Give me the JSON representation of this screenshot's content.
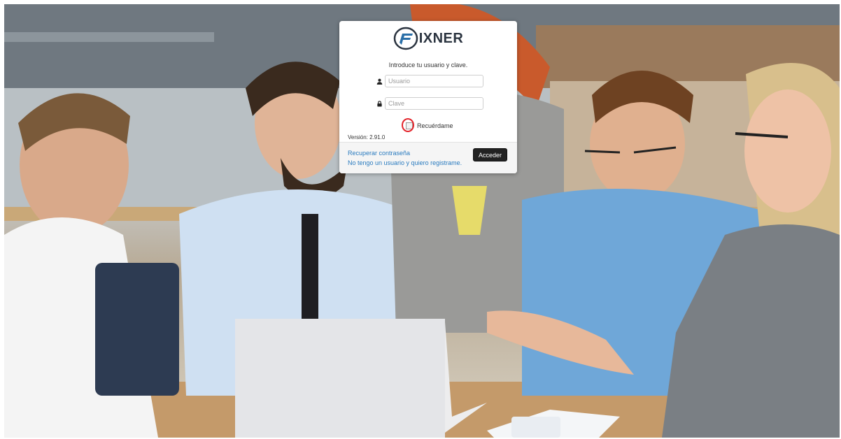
{
  "brand": {
    "name": "IXNER",
    "logo_icon": "fixner-f-logo-icon",
    "color": "#2b3440",
    "accent": "#2a6fa8"
  },
  "login": {
    "intro": "Introduce tu usuario y clave.",
    "username_placeholder": "Usuario",
    "username_value": "",
    "username_icon": "user-icon",
    "password_placeholder": "Clave",
    "password_value": "",
    "password_icon": "lock-icon",
    "remember_label": "Recuérdame",
    "remember_checked": false,
    "version": "Versión: 2.91.0",
    "recover_link": "Recuperar contraseña",
    "register_link": "No tengo un usuario y quiero registrame.",
    "submit_label": "Acceder"
  },
  "colors": {
    "link": "#2a7bbf",
    "button_bg": "#222222",
    "highlight_ring": "#e3242b"
  }
}
